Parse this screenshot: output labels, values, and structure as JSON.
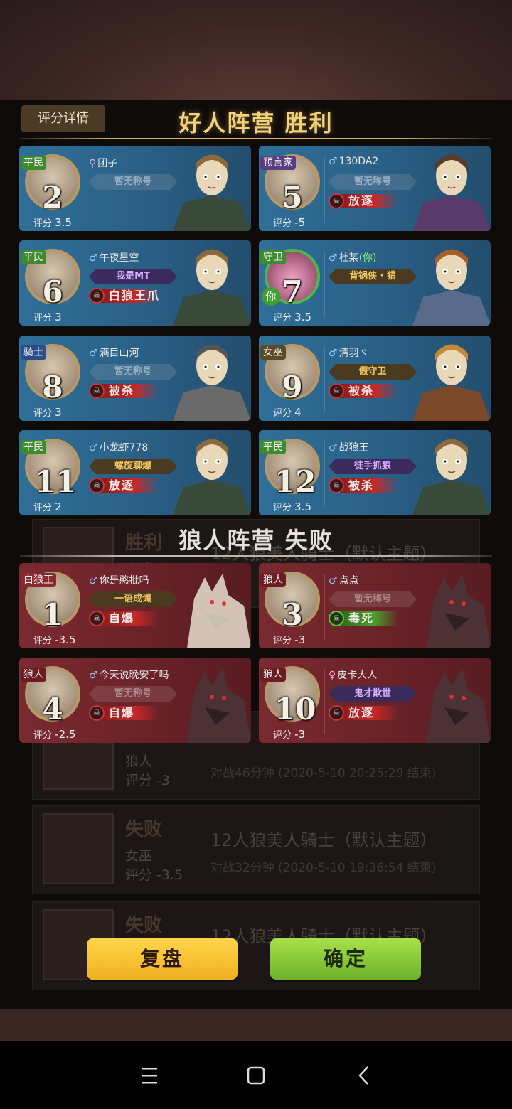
{
  "header": {
    "score_detail": "评分详情",
    "good_camp": "好人阵营  胜利",
    "wolf_camp": "狼人阵营  失败"
  },
  "good_players": [
    {
      "seat": "2",
      "role": "平民",
      "role_color": "green",
      "gender": "♀",
      "name": "团子",
      "title": "暂无称号",
      "title_style": "none",
      "status": "",
      "score_label": "评分",
      "score": "3.5",
      "char": "priest"
    },
    {
      "seat": "5",
      "role": "预言家",
      "role_color": "purple",
      "gender": "♂",
      "name": "130DA2",
      "title": "暂无称号",
      "title_style": "none",
      "status": "放逐",
      "score_label": "评分",
      "score": "-5",
      "char": "seer"
    },
    {
      "seat": "6",
      "role": "平民",
      "role_color": "green",
      "gender": "♂",
      "name": "午夜星空",
      "title": "我是MT",
      "title_style": "purple",
      "status": "白狼王爪",
      "score_label": "评分",
      "score": "3",
      "char": "priest"
    },
    {
      "seat": "7",
      "role": "守卫",
      "role_color": "green",
      "gender": "♂",
      "name": "杜某",
      "you": "(你)",
      "title": "背锅侠 · 猎",
      "title_style": "gold",
      "status": "",
      "score_label": "评分",
      "score": "3.5",
      "char": "guard",
      "you_badge": "你"
    },
    {
      "seat": "8",
      "role": "骑士",
      "role_color": "blue",
      "gender": "♂",
      "name": "满目山河",
      "title": "暂无称号",
      "title_style": "none",
      "status": "被杀",
      "score_label": "评分",
      "score": "3",
      "char": "knight"
    },
    {
      "seat": "9",
      "role": "女巫",
      "role_color": "gold",
      "gender": "♂",
      "name": "清羽ヾ",
      "title": "假守卫",
      "title_style": "gold",
      "status": "被杀",
      "score_label": "评分",
      "score": "4",
      "char": "witch"
    },
    {
      "seat": "11",
      "role": "平民",
      "role_color": "green",
      "gender": "♂",
      "name": "小龙虾778",
      "title": "螺旋聊爆",
      "title_style": "gold",
      "status": "放逐",
      "score_label": "评分",
      "score": "2",
      "char": "priest"
    },
    {
      "seat": "12",
      "role": "平民",
      "role_color": "green",
      "gender": "♂",
      "name": "战狼王",
      "title": "徒手抓狼",
      "title_style": "purple",
      "status": "被杀",
      "score_label": "评分",
      "score": "3.5",
      "char": "priest"
    }
  ],
  "wolf_players": [
    {
      "seat": "1",
      "role": "白狼王",
      "role_color": "red",
      "gender": "♂",
      "name": "你是憨批吗",
      "title": "一语成谶",
      "title_style": "gold",
      "status": "自爆",
      "score_label": "评分",
      "score": "-3.5",
      "char": "whitewolf"
    },
    {
      "seat": "3",
      "role": "狼人",
      "role_color": "dred",
      "gender": "♂",
      "name": "点点",
      "title": "暂无称号",
      "title_style": "none-red",
      "status": "毒死",
      "status_kind": "poison",
      "score_label": "评分",
      "score": "-3",
      "char": "wolf"
    },
    {
      "seat": "4",
      "role": "狼人",
      "role_color": "dred",
      "gender": "♂",
      "name": "今天说晚安了吗",
      "title": "暂无称号",
      "title_style": "none-red",
      "status": "自爆",
      "score_label": "评分",
      "score": "-2.5",
      "char": "wolf"
    },
    {
      "seat": "10",
      "role": "狼人",
      "role_color": "dred",
      "gender": "♀",
      "name": "皮卡大人",
      "title": "鬼才欺世",
      "title_style": "purple",
      "status": "放逐",
      "score_label": "评分",
      "score": "-3",
      "char": "wolf"
    }
  ],
  "background_list": [
    {
      "result": "胜利",
      "role": "白狼王",
      "score": "",
      "title": "12人狼美人骑士（默认主题）",
      "sub": ""
    },
    {
      "result": "",
      "role": "狼人",
      "score": "评分 -3",
      "title": "",
      "sub": "对战46分钟 (2020-5-10 20:25:29 结束)"
    },
    {
      "result": "失败",
      "role": "女巫",
      "score": "评分 -3.5",
      "title": "12人狼美人骑士（默认主题）",
      "sub": "对战32分钟 (2020-5-10 19:36:54 结束)"
    },
    {
      "result": "失败",
      "role": "",
      "score": "",
      "title": "12人狼美人骑士（默认主题）",
      "sub": ""
    }
  ],
  "buttons": {
    "replay": "复盘",
    "confirm": "确定"
  },
  "nav": {
    "menu_icon": "menu-icon",
    "home_icon": "home-icon",
    "back_icon": "back-icon"
  }
}
